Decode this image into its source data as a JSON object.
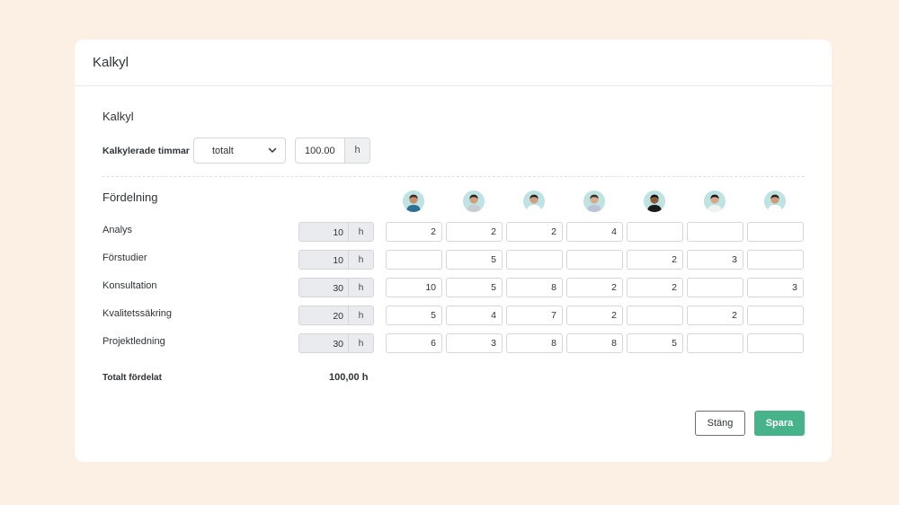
{
  "card": {
    "title": "Kalkyl"
  },
  "kalkyl": {
    "section_title": "Kalkyl",
    "hours_label": "Kalkylerade timmar",
    "mode_select_value": "totalt",
    "total_hours_value": "100.00",
    "total_hours_unit": "h"
  },
  "fordelning": {
    "section_title": "Fördelning",
    "hour_unit": "h",
    "avatars": [
      {
        "icon": "person-avatar",
        "hair": "#3b2a22",
        "skin": "#c58d69",
        "shirt": "#2f6f8f"
      },
      {
        "icon": "person-avatar",
        "hair": "#2b211c",
        "skin": "#d0a07f",
        "shirt": "#c9ccd0"
      },
      {
        "icon": "person-avatar",
        "hair": "#2a2320",
        "skin": "#cf9f80",
        "shirt": "#ffffff"
      },
      {
        "icon": "person-avatar",
        "hair": "#3a2e26",
        "skin": "#d9ad8c",
        "shirt": "#bcc3d6"
      },
      {
        "icon": "person-avatar",
        "hair": "#16110f",
        "skin": "#8c5a3d",
        "shirt": "#1b1b1b"
      },
      {
        "icon": "person-avatar",
        "hair": "#1a1412",
        "skin": "#d8a88a",
        "shirt": "#f2f2f2"
      },
      {
        "icon": "person-avatar",
        "hair": "#2b1f19",
        "skin": "#cf9c7a",
        "shirt": "#ffffff"
      }
    ],
    "rows": [
      {
        "label": "Analys",
        "hours": "10",
        "values": [
          "2",
          "2",
          "2",
          "4",
          "",
          "",
          ""
        ]
      },
      {
        "label": "Förstudier",
        "hours": "10",
        "values": [
          "",
          "5",
          "",
          "",
          "2",
          "3",
          ""
        ]
      },
      {
        "label": "Konsultation",
        "hours": "30",
        "values": [
          "10",
          "5",
          "8",
          "2",
          "2",
          "",
          "3"
        ]
      },
      {
        "label": "Kvalitetssäkring",
        "hours": "20",
        "values": [
          "5",
          "4",
          "7",
          "2",
          "",
          "2",
          ""
        ]
      },
      {
        "label": "Projektledning",
        "hours": "30",
        "values": [
          "6",
          "3",
          "8",
          "8",
          "5",
          "",
          ""
        ]
      }
    ],
    "total_label": "Totalt fördelat",
    "total_value": "100,00 h"
  },
  "buttons": {
    "close_label": "Stäng",
    "save_label": "Spara"
  },
  "colors": {
    "background": "#fcefe3",
    "accent": "#47b38b",
    "avatar_bg": "#bfe3e3"
  }
}
